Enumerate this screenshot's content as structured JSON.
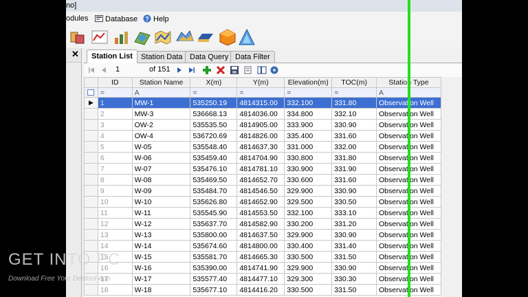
{
  "window": {
    "title_fragment": "no]"
  },
  "menu": [
    {
      "label": "odules",
      "icon": ""
    },
    {
      "label": "Database",
      "icon": "database-icon"
    },
    {
      "label": "Help",
      "icon": "help-icon"
    }
  ],
  "toolbar_icons": [
    "import-icon",
    "table-chart-icon",
    "line-chart-icon",
    "cross-section-icon",
    "map-icon",
    "contour-map-icon",
    "fence-diagram-icon",
    "3d-model-icon",
    "plume-icon"
  ],
  "tabs": [
    "Station List",
    "Station Data",
    "Data Query",
    "Data Filter"
  ],
  "nav": {
    "record": "1",
    "of_label": "of 151"
  },
  "nav_icons": [
    "first-record-icon",
    "prev-record-icon",
    "next-record-icon",
    "last-record-icon",
    "add-record-icon",
    "delete-record-icon",
    "save-icon",
    "edit-icon",
    "columns-icon",
    "settings-icon"
  ],
  "grid": {
    "columns": [
      "ID",
      "Station Name",
      "X(m)",
      "Y(m)",
      "Elevation(m)",
      "TOC(m)",
      "Station Type"
    ],
    "filter_row": [
      "=",
      "A",
      "=",
      "=",
      "=",
      "=",
      "A"
    ],
    "rows": [
      [
        "1",
        "MW-1",
        "535250.19",
        "4814315.00",
        "332.100",
        "331.80",
        "Observation Well"
      ],
      [
        "2",
        "MW-3",
        "536668.13",
        "4814036.00",
        "334.800",
        "332.10",
        "Observation Well"
      ],
      [
        "3",
        "OW-2",
        "535535.50",
        "4814905.00",
        "333.900",
        "330.90",
        "Observation Well"
      ],
      [
        "4",
        "OW-4",
        "536720.69",
        "4814826.00",
        "335.400",
        "331.60",
        "Observation Well"
      ],
      [
        "5",
        "W-05",
        "535548.40",
        "4814637.30",
        "331.000",
        "332.00",
        "Observation Well"
      ],
      [
        "6",
        "W-06",
        "535459.40",
        "4814704.90",
        "330.800",
        "331.80",
        "Observation Well"
      ],
      [
        "7",
        "W-07",
        "535476.10",
        "4814781.10",
        "330.900",
        "331.90",
        "Observation Well"
      ],
      [
        "8",
        "W-08",
        "535469.50",
        "4814652.70",
        "330.600",
        "331.60",
        "Observation Well"
      ],
      [
        "9",
        "W-09",
        "535484.70",
        "4814546.50",
        "329.900",
        "330.90",
        "Observation Well"
      ],
      [
        "10",
        "W-10",
        "535626.80",
        "4814652.90",
        "329.500",
        "330.50",
        "Observation Well"
      ],
      [
        "11",
        "W-11",
        "535545.90",
        "4814553.50",
        "332.100",
        "333.10",
        "Observation Well"
      ],
      [
        "12",
        "W-12",
        "535637.70",
        "4814582.90",
        "330.200",
        "331.20",
        "Observation Well"
      ],
      [
        "13",
        "W-13",
        "535800.00",
        "4814637.50",
        "329.900",
        "330.90",
        "Observation Well"
      ],
      [
        "14",
        "W-14",
        "535674.60",
        "4814800.00",
        "330.400",
        "331.40",
        "Observation Well"
      ],
      [
        "15",
        "W-15",
        "535581.70",
        "4814665.30",
        "330.500",
        "331.50",
        "Observation Well"
      ],
      [
        "16",
        "W-16",
        "535390.00",
        "4814741.90",
        "329.900",
        "330.90",
        "Observation Well"
      ],
      [
        "17",
        "W-17",
        "535577.40",
        "4814477.10",
        "329.300",
        "330.30",
        "Observation Well"
      ],
      [
        "18",
        "W-18",
        "535677.10",
        "4814416.20",
        "330.500",
        "331.50",
        "Observation Well"
      ]
    ],
    "active_row_index": 0
  },
  "watermark": {
    "title": "GET INTO PC",
    "subtitle": "Download Free Your Desired App"
  },
  "colors": {
    "selection": "#3d6fd2",
    "guide_line": "#21e21a",
    "filter_bg": "#eef1fb"
  }
}
